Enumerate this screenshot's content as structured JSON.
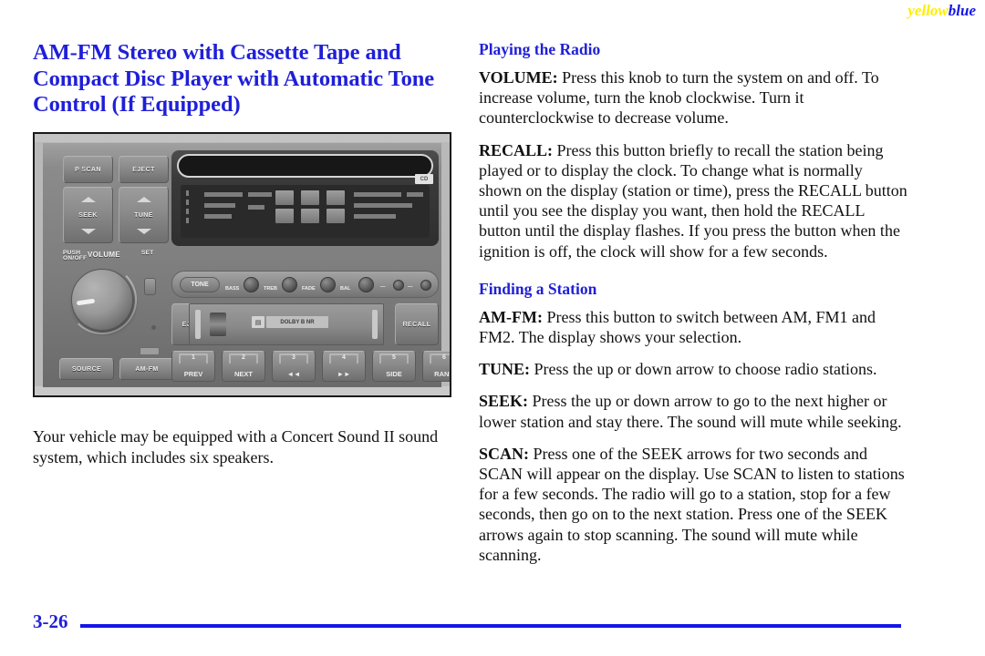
{
  "page": {
    "number": "3-26",
    "color_marks": {
      "yellow": "yellow",
      "blue": "blue"
    }
  },
  "left_column": {
    "section_title": "AM-FM Stereo with Cassette Tape and Compact Disc Player with Automatic Tone Control (If Equipped)",
    "caption": "Your vehicle may be equipped with a Concert Sound II sound system, which includes six speakers."
  },
  "figure": {
    "alt": "Illustration of the AM-FM stereo with cassette tape and compact disc player faceplate",
    "controls": {
      "p_scan": "P SCAN",
      "eject_top": "EJECT",
      "seek": "SEEK",
      "tune": "TUNE",
      "volume_label": "VOLUME",
      "push_on_off": "PUSH\nON/OFF",
      "set_label": "SET",
      "source": "SOURCE",
      "am_fm": "AM-FM",
      "tone": "TONE",
      "bass": "BASS",
      "treb": "TREB",
      "fade": "FADE",
      "bal": "BAL",
      "eject_cassette": "EJECT",
      "recall": "RECALL",
      "cassette_tag": "DOLBY B NR",
      "display_badge": "CD",
      "mini_chip": "TAPE"
    },
    "presets": [
      {
        "num": "1",
        "name": "PREV"
      },
      {
        "num": "2",
        "name": "NEXT"
      },
      {
        "num": "3",
        "name": "◄◄"
      },
      {
        "num": "4",
        "name": "►►"
      },
      {
        "num": "5",
        "name": "SIDE"
      },
      {
        "num": "6",
        "name": "RAND"
      }
    ]
  },
  "right_column": {
    "heading_playing": "Playing the Radio",
    "heading_finding": "Finding a Station",
    "paragraphs": [
      {
        "term": "VOLUME:",
        "text": " Press this knob to turn the system on and off. To increase volume, turn the knob clockwise. Turn it counterclockwise to decrease volume."
      },
      {
        "term": "RECALL:",
        "text": " Press this button briefly to recall the station being played or to display the clock. To change what is normally shown on the display (station or time), press the RECALL button until you see the display you want, then hold the RECALL button until the display flashes. If you press the button when the ignition is off, the clock will show for a few seconds."
      }
    ],
    "paragraphs2": [
      {
        "term": "AM-FM:",
        "text": " Press this button to switch between AM, FM1 and FM2. The display shows your selection."
      },
      {
        "term": "TUNE:",
        "text": " Press the up or down arrow to choose radio stations."
      },
      {
        "term": "SEEK:",
        "text": " Press the up or down arrow to go to the next higher or lower station and stay there. The sound will mute while seeking."
      },
      {
        "term": "SCAN:",
        "text": " Press one of the SEEK arrows for two seconds and SCAN will appear on the display. Use SCAN to listen to stations for a few seconds. The radio will go to a station, stop for a few seconds, then go on to the next station. Press one of the SEEK arrows again to stop scanning. The sound will mute while scanning."
      }
    ]
  },
  "colors": {
    "heading_blue": "#1f1fd8",
    "mark_yellow": "#ffee00",
    "mark_blue": "#1515e8",
    "body_text": "#111111"
  }
}
